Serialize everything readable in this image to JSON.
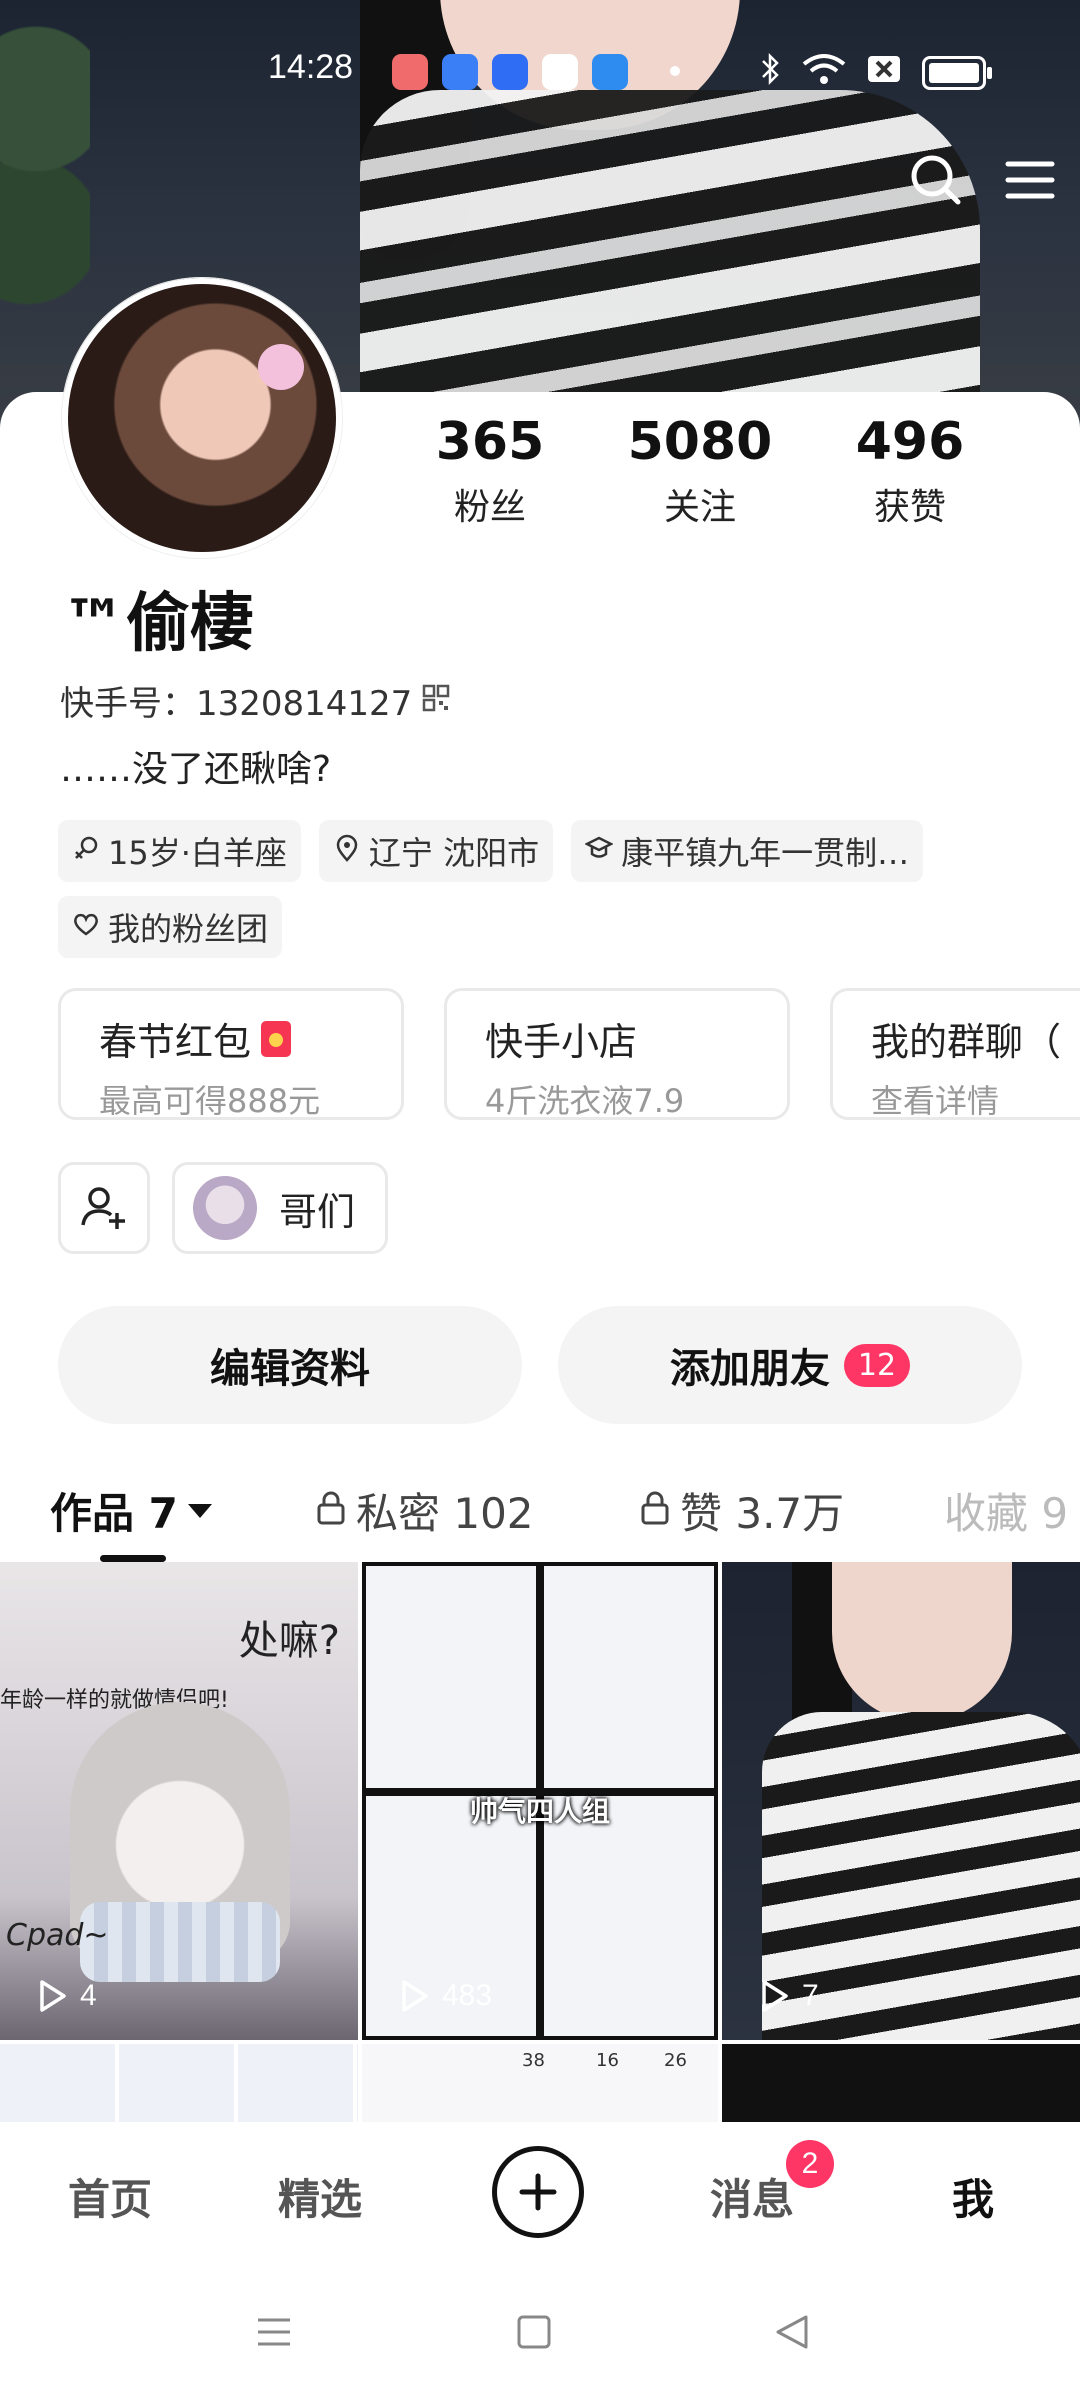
{
  "status_bar": {
    "time": "14:28",
    "app_icons": [
      "#f06b6b",
      "#3a7ff6",
      "#2f6df5",
      "#ffffff",
      "#2e8bf0"
    ],
    "icons": [
      "bluetooth-icon",
      "wifi-icon",
      "sim-off-icon",
      "battery-icon"
    ]
  },
  "header_icons": [
    "search-icon",
    "menu-icon"
  ],
  "profile": {
    "name": "™偷棲",
    "kuaishou_id": "快手号：1320814127",
    "bio": "……没了还瞅啥?",
    "stats": [
      {
        "num": "365",
        "label": "粉丝"
      },
      {
        "num": "5080",
        "label": "关注"
      },
      {
        "num": "496",
        "label": "获赞"
      }
    ],
    "tags": [
      "15岁·白羊座",
      "辽宁 沈阳市",
      "康平镇九年一贯制…",
      "我的粉丝团"
    ]
  },
  "promos": [
    {
      "title": "春节红包",
      "sub": "最高可得888元"
    },
    {
      "title": "快手小店",
      "sub": "4斤洗衣液7.9"
    },
    {
      "title": "我的群聊（",
      "sub": "查看详情"
    }
  ],
  "friend_chip": "哥们",
  "actions": {
    "edit": "编辑资料",
    "add_friend": "添加朋友",
    "add_friend_badge": "12"
  },
  "tabs": [
    {
      "label": "作品 7",
      "active": true
    },
    {
      "label": "私密 102"
    },
    {
      "label": "赞 3.7万"
    },
    {
      "label": "收藏 9"
    }
  ],
  "works": [
    {
      "plays": "4",
      "title_text": "处嘛?",
      "overlay_text": "年龄一样的就做情侣吧!",
      "sig": "Cpad~"
    },
    {
      "plays": "483",
      "overlay_text": "帅气四人组"
    },
    {
      "plays": "7"
    }
  ],
  "row2_numbers": [
    "38",
    "16",
    "26"
  ],
  "bottom_nav": {
    "home": "首页",
    "featured": "精选",
    "messages": "消息",
    "messages_badge": "2",
    "me": "我"
  }
}
